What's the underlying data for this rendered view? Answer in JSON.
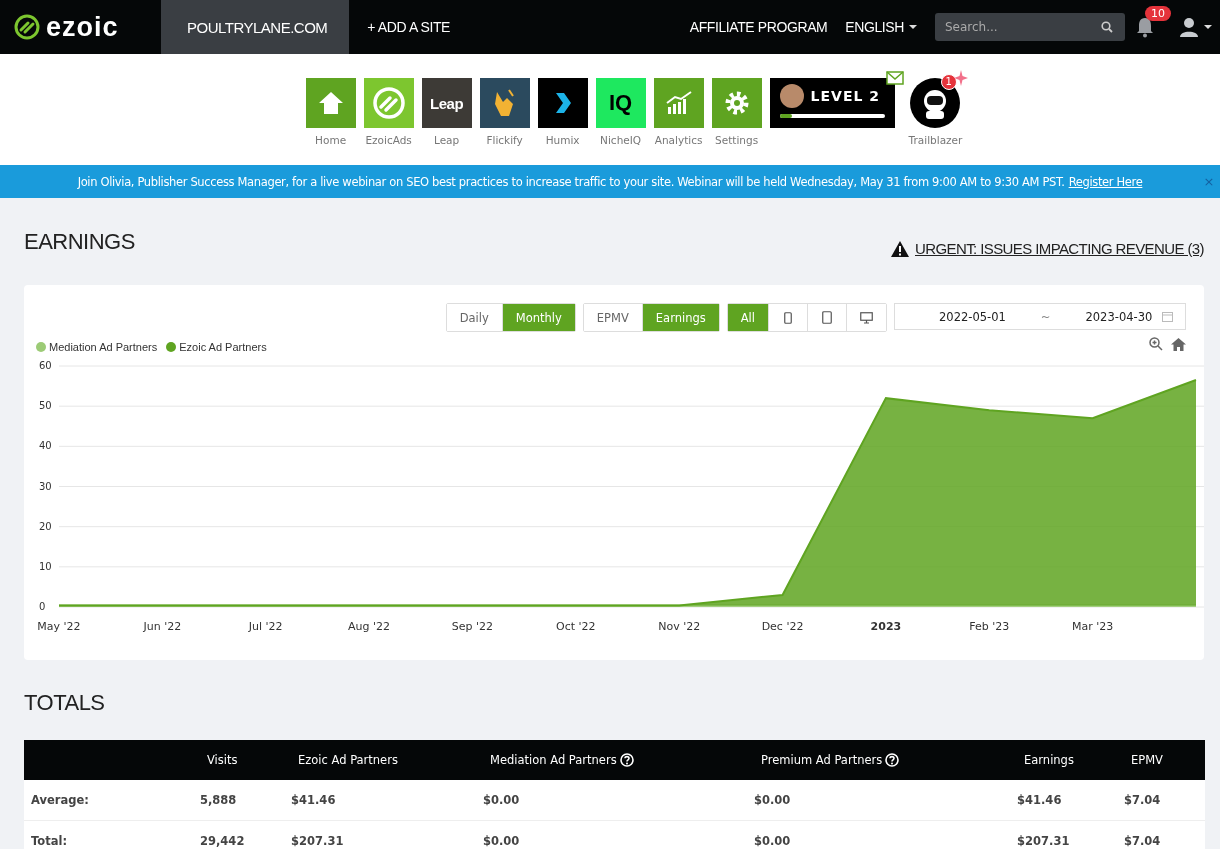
{
  "nav": {
    "logo": "ezoic",
    "site": "POULTRYLANE.COM",
    "add_site": "+ ADD A SITE",
    "affiliate": "AFFILIATE PROGRAM",
    "language": "ENGLISH",
    "search": {
      "placeholder": "Search..."
    },
    "notifications": "10"
  },
  "apps": [
    {
      "label": "Home",
      "kind": "home",
      "color": "#5fa421"
    },
    {
      "label": "EzoicAds",
      "kind": "ezoic",
      "color": "#7dc62f"
    },
    {
      "label": "Leap",
      "kind": "leap",
      "color": "#3d3a36",
      "glyph": "Leap"
    },
    {
      "label": "Flickify",
      "kind": "flickify",
      "color": "#2b4a5e"
    },
    {
      "label": "Humix",
      "kind": "humix",
      "color": "#000000"
    },
    {
      "label": "NicheIQ",
      "kind": "iq",
      "color": "#1ee85f",
      "glyph": "IQ"
    },
    {
      "label": "Analytics",
      "kind": "analytics",
      "color": "#5fa421"
    },
    {
      "label": "Settings",
      "kind": "settings",
      "color": "#5fa421"
    }
  ],
  "level_card": {
    "title": "LEVEL 2",
    "level": 0.12
  },
  "trailblazer": {
    "label": "Trailblazer",
    "badge": "1"
  },
  "banner": {
    "text": "Join Olivia, Publisher Success Manager, for a live webinar on SEO best practices to increase traffic to your site. Webinar will be held Wednesday, May 31 from 9:00 AM to 9:30 AM PST.",
    "link": "Register Here",
    "close": "×"
  },
  "earnings": {
    "title": "EARNINGS",
    "urgent": "URGENT: ISSUES IMPACTING REVENUE (3)"
  },
  "period_toggle": [
    {
      "label": "Daily",
      "selected": false
    },
    {
      "label": "Monthly",
      "selected": true
    }
  ],
  "metric_toggle": [
    {
      "label": "EPMV",
      "selected": false
    },
    {
      "label": "Earnings",
      "selected": true
    }
  ],
  "device_toggle": [
    {
      "label": "All",
      "kind": "text",
      "selected": true
    },
    {
      "kind": "phone",
      "selected": false
    },
    {
      "kind": "tablet",
      "selected": false
    },
    {
      "kind": "desktop",
      "selected": false
    }
  ],
  "date_range": {
    "start": "2022-05-01",
    "separator": "~",
    "end": "2023-04-30"
  },
  "chart": {
    "chart_data": {
      "type": "area",
      "categories": [
        "May '22",
        "Jun '22",
        "Jul '22",
        "Aug '22",
        "Sep '22",
        "Oct '22",
        "Nov '22",
        "Dec '22",
        "2023",
        "Feb '23",
        "Mar '23",
        null
      ],
      "ylim": [
        0,
        60
      ],
      "yticks": [
        0,
        10,
        20,
        30,
        40,
        50,
        60
      ],
      "stacked": true,
      "grid": true,
      "series": [
        {
          "name": "Mediation Ad Partners",
          "color": "#9ccb76",
          "values": [
            0.4,
            0.4,
            0.4,
            0.4,
            0.4,
            0.4,
            0.4,
            0.4,
            0.4,
            0.4,
            0.4,
            0.4
          ]
        },
        {
          "name": "Ezoic Ad Partners",
          "color": "#5fa421",
          "values": [
            0,
            0,
            0,
            0,
            0,
            0,
            0,
            2.6,
            51.6,
            48.6,
            46.6,
            56.1
          ]
        }
      ]
    }
  },
  "totals": {
    "title": "TOTALS",
    "columns": [
      {
        "label": "Visits",
        "help": false
      },
      {
        "label": "Ezoic Ad Partners",
        "help": false
      },
      {
        "label": "Mediation Ad Partners",
        "help": true
      },
      {
        "label": "Premium Ad Partners",
        "help": true
      },
      {
        "label": "Earnings",
        "help": false
      },
      {
        "label": "EPMV",
        "help": false
      }
    ],
    "rows": [
      {
        "label": "Average:",
        "cells": [
          "5,888",
          "$41.46",
          "$0.00",
          "$0.00",
          "$41.46",
          "$7.04"
        ]
      },
      {
        "label": "Total:",
        "cells": [
          "29,442",
          "$207.31",
          "$0.00",
          "$0.00",
          "$207.31",
          "$7.04"
        ]
      }
    ]
  }
}
